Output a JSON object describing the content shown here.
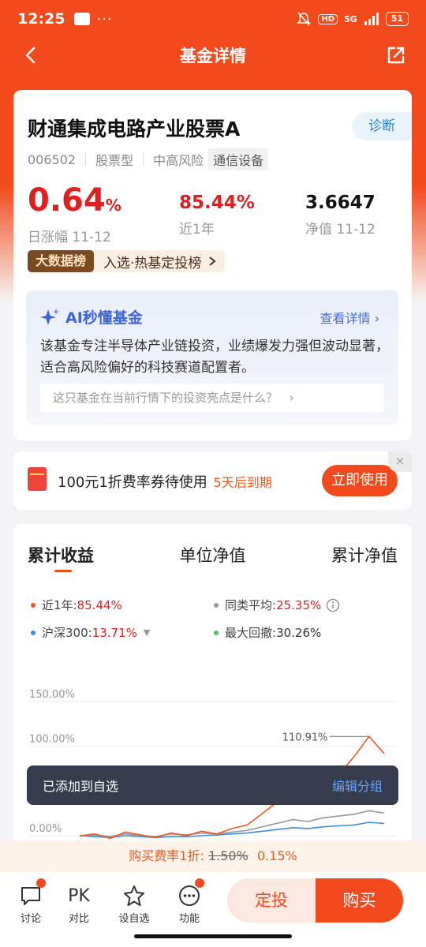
{
  "status": {
    "time": "12:25",
    "more": "···",
    "network": "5G",
    "hd": "HD",
    "battery": "51"
  },
  "nav": {
    "title": "基金详情"
  },
  "fund": {
    "name": "财通集成电路产业股票A",
    "diagnose_label": "诊断",
    "code": "006502",
    "type": "股票型",
    "risk": "中高风险",
    "sector": "通信设备",
    "day_change": "0.64",
    "day_change_unit": "%",
    "day_change_label": "日涨幅 11-12",
    "year_return": "85.44%",
    "year_return_label": "近1年",
    "nav_value": "3.6647",
    "nav_label": "净值 11-12",
    "bigdata_tag": "大数据榜",
    "bigdata_text": "入选·热基定投榜"
  },
  "ai": {
    "title": "AI秒懂基金",
    "more": "查看详情",
    "desc": "该基金专注半导体产业链投资，业绩爆发力强但波动显著，适合高风险偏好的科技赛道配置者。",
    "question": "这只基金在当前行情下的投资亮点是什么？"
  },
  "coupon": {
    "text": "100元1折费率券待使用",
    "expire": "5天后到期",
    "button": "立即使用",
    "close": "×"
  },
  "chart_tabs": [
    "累计收益",
    "单位净值",
    "累计净值"
  ],
  "legend": [
    {
      "label": "近1年:",
      "value": "85.44%",
      "color": "#f05a24"
    },
    {
      "label": "同类平均:",
      "value": "25.35%",
      "color": "#999999"
    },
    {
      "label": "沪深300:",
      "value": "13.71%",
      "color": "#3b8ee0"
    },
    {
      "label": "最大回撤:",
      "value": "30.26%",
      "color": "#4fbf63"
    }
  ],
  "chart_data": {
    "type": "line",
    "y_ticks": [
      "150.00%",
      "100.00%",
      "0.00%"
    ],
    "peak_label": "110.91%",
    "series": [
      {
        "name": "近1年",
        "color": "#f05a24",
        "values": [
          0,
          2,
          -3,
          4,
          1,
          -2,
          3,
          0,
          5,
          2,
          8,
          12,
          25,
          38,
          55,
          48,
          70,
          68,
          88,
          110.91,
          92
        ]
      },
      {
        "name": "同类平均",
        "color": "#999999",
        "values": [
          0,
          1,
          -1,
          2,
          0,
          -1,
          2,
          1,
          3,
          2,
          4,
          6,
          10,
          14,
          18,
          16,
          20,
          22,
          24,
          28,
          25.35
        ]
      },
      {
        "name": "沪深300",
        "color": "#3b8ee0",
        "values": [
          0,
          -1,
          -2,
          0,
          -1,
          -2,
          -1,
          -1,
          0,
          1,
          2,
          3,
          5,
          7,
          9,
          8,
          10,
          11,
          12,
          15,
          13.71
        ]
      }
    ]
  },
  "toast": {
    "text": "已添加到自选",
    "action": "编辑分组"
  },
  "fee": {
    "prefix": "购买费率1折:",
    "old": "1.50%",
    "new": "0.15%"
  },
  "bottom": {
    "discuss": "讨论",
    "pk_icon": "PK",
    "compare": "对比",
    "watch": "设自选",
    "func": "功能",
    "dingtou": "定投",
    "buy": "购买"
  }
}
